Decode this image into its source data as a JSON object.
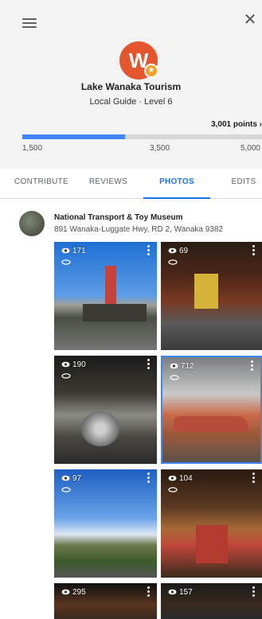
{
  "header": {
    "menu_icon": "menu-icon",
    "close_icon": "close-icon",
    "close_glyph": "✕",
    "avatar_letter": "W",
    "avatar_badge_glyph": "★",
    "name": "Lake Wanaka Tourism",
    "level": "Local Guide · Level 6",
    "points": "3,001 points ›",
    "progress_fraction": 0.43,
    "ticks": [
      "1,500",
      "3,500",
      "5,000"
    ]
  },
  "tabs": [
    "CONTRIBUTE",
    "REVIEWS",
    "PHOTOS",
    "EDITS"
  ],
  "active_tab": "PHOTOS",
  "place": {
    "name": "National Transport & Toy Museum",
    "address": "891 Wanaka-Luggate Hwy, RD 2, Wanaka 9382"
  },
  "photos": [
    {
      "views": "171"
    },
    {
      "views": "69"
    },
    {
      "views": "190"
    },
    {
      "views": "712"
    },
    {
      "views": "97"
    },
    {
      "views": "104"
    },
    {
      "views": "295"
    },
    {
      "views": "157"
    }
  ],
  "colors": {
    "accent": "#1a73e8",
    "progress": "#4285f4",
    "avatar": "#e4572e",
    "badge": "#f4a12c"
  }
}
